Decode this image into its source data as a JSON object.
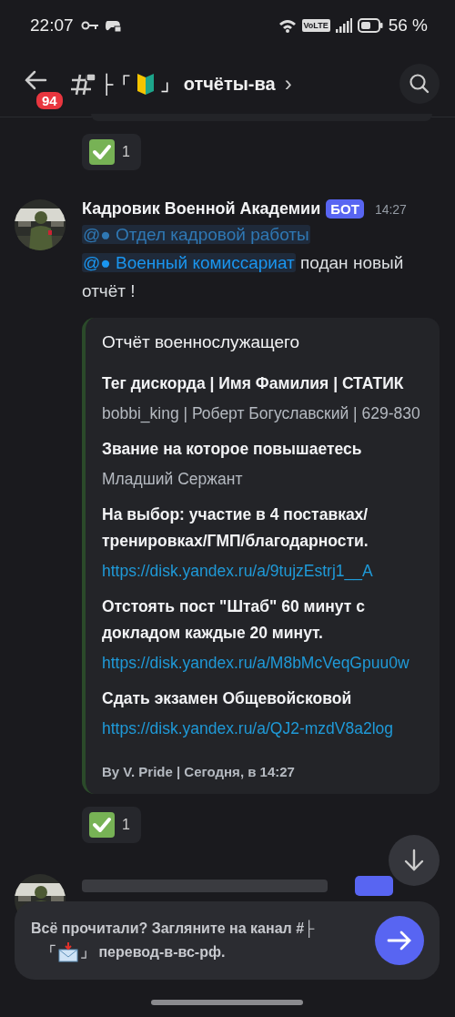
{
  "status_bar": {
    "time": "22:07",
    "network": "VoLTE",
    "battery": "56 %"
  },
  "header": {
    "unread_badge": "94",
    "channel_prefix": "├「",
    "channel_suffix": "」 отчёты-ва",
    "chevron": "›"
  },
  "messages": [
    {
      "kind": "tail",
      "reaction": {
        "count": "1"
      }
    },
    {
      "kind": "full",
      "author": "Кадровик Военной Академии",
      "tag": "БОТ",
      "time": "14:27",
      "mentions": [
        {
          "text": "@● Отдел кадровой работы",
          "color": "#2f78b4"
        },
        {
          "text": "@● Военный комиссариат",
          "color": "#1a96f0"
        }
      ],
      "body": " подан новый отчёт !",
      "embed": {
        "title": "Отчёт военнослужащего",
        "fields": [
          {
            "name": "Тег дискорда | Имя Фамилия | СТАТИК",
            "value": "bobbi_king | Роберт Богуславский | 629-830",
            "kind": "text"
          },
          {
            "name": "Звание на которое повышаетесь",
            "value": "Младший Сержант",
            "kind": "text"
          },
          {
            "name": "На выбор: участие в 4 поставках/тренировках/ГМП/благодарности.",
            "value": "https://disk.yandex.ru/a/9tujzEstrj1__A",
            "kind": "link"
          },
          {
            "name": "Отстоять пост \"Штаб\" 60 минут с докладом каждые 20 минут.",
            "value": "https://disk.yandex.ru/a/M8bMcVeqGpuu0w",
            "kind": "link"
          },
          {
            "name": "Сдать экзамен Общевойсковой",
            "value": "https://disk.yandex.ru/a/QJ2-mzdV8a2log",
            "kind": "link"
          }
        ],
        "footer": "By V. Pride | Сегодня, в 14:27"
      },
      "reaction": {
        "count": "1"
      }
    },
    {
      "kind": "cut"
    }
  ],
  "notice": {
    "line_1": "Всё прочитали? Загляните на канал #├",
    "bracket": "「",
    "channel": "」 перевод-в-вс-рф."
  }
}
